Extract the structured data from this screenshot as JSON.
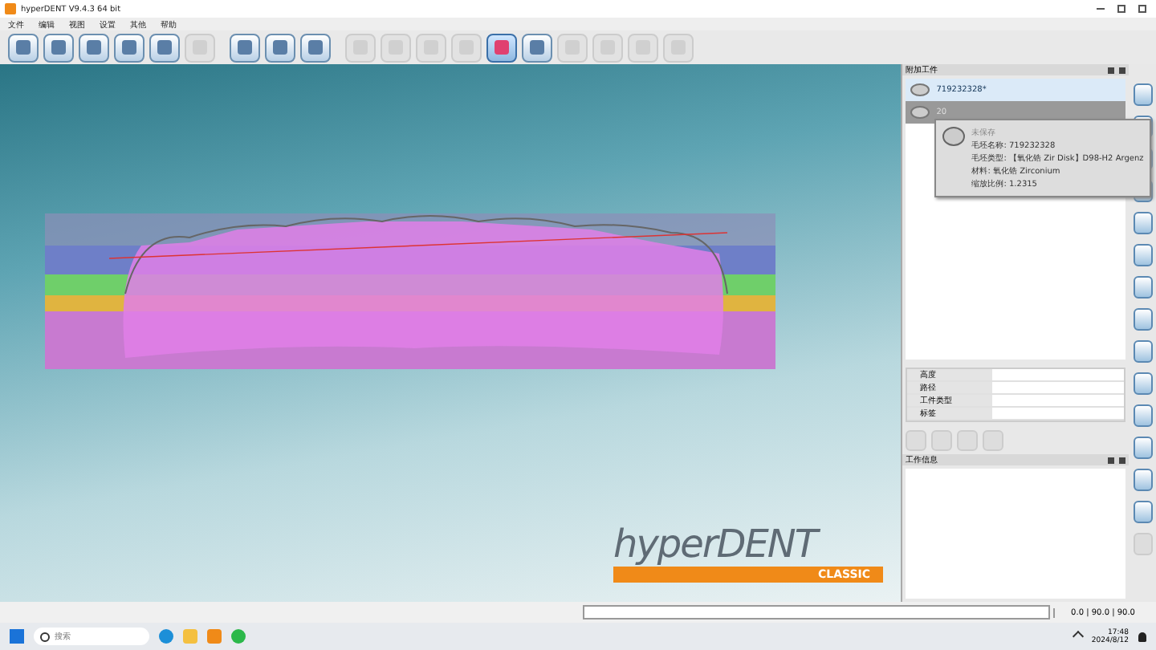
{
  "window": {
    "title": "hyperDENT V9.4.3 64 bit"
  },
  "menu": [
    "文件",
    "编辑",
    "视图",
    "设置",
    "其他",
    "帮助"
  ],
  "toolbar": [
    {
      "disabled": false,
      "selected": false
    },
    {
      "disabled": false,
      "selected": false
    },
    {
      "disabled": false,
      "selected": false
    },
    {
      "disabled": false,
      "selected": false
    },
    {
      "disabled": false,
      "selected": false
    },
    {
      "disabled": true,
      "selected": false
    },
    {
      "disabled": false,
      "selected": false
    },
    {
      "disabled": false,
      "selected": false
    },
    {
      "disabled": false,
      "selected": false
    },
    {
      "disabled": true,
      "selected": false
    },
    {
      "disabled": true,
      "selected": false
    },
    {
      "disabled": true,
      "selected": false
    },
    {
      "disabled": true,
      "selected": false
    },
    {
      "disabled": false,
      "selected": true
    },
    {
      "disabled": false,
      "selected": false
    },
    {
      "disabled": true,
      "selected": false
    },
    {
      "disabled": true,
      "selected": false
    },
    {
      "disabled": true,
      "selected": false
    },
    {
      "disabled": true,
      "selected": false
    }
  ],
  "logo": {
    "name": "hyperDENT",
    "edition": "CLASSIC"
  },
  "workpieces": {
    "title": "附加工件",
    "items": [
      {
        "label": "719232328*",
        "selected": true
      },
      {
        "label": "20",
        "selected": false
      }
    ]
  },
  "tooltip": {
    "title": "未保存",
    "lines": [
      "毛坯名称: 719232328",
      "毛坯类型: 【氧化锆 Zir Disk】D98-H2 Argenz",
      "材料: 氧化锆 Zirconium",
      "缩放比例: 1.2315"
    ]
  },
  "properties": [
    {
      "name": "高度"
    },
    {
      "name": "路径"
    },
    {
      "name": "工件类型"
    },
    {
      "name": "标签"
    }
  ],
  "panel_buttons": [
    {
      "disabled": true
    },
    {
      "disabled": true
    },
    {
      "disabled": true
    },
    {
      "disabled": true
    }
  ],
  "info_panel": {
    "title": "工作信息"
  },
  "side_strip": [
    {
      "disabled": false
    },
    {
      "disabled": false
    },
    {
      "disabled": false
    },
    {
      "disabled": false
    },
    {
      "disabled": false
    },
    {
      "disabled": false
    },
    {
      "disabled": false
    },
    {
      "disabled": false
    },
    {
      "disabled": false
    },
    {
      "disabled": false
    },
    {
      "disabled": false
    },
    {
      "disabled": false
    },
    {
      "disabled": false
    },
    {
      "disabled": false
    },
    {
      "disabled": true
    }
  ],
  "status_bar": {
    "coordinates": "0.0 | 90.0 | 90.0"
  },
  "taskbar": {
    "search_placeholder": "搜索",
    "time": "17:48",
    "date": "2024/8/12"
  }
}
